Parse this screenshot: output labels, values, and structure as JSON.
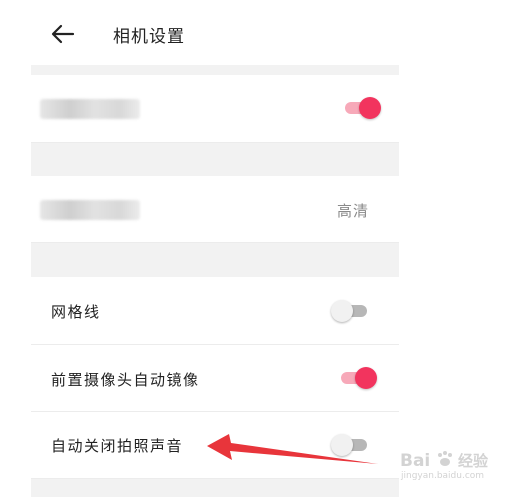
{
  "header": {
    "title": "相机设置",
    "back_icon": "back-arrow-icon"
  },
  "settings": {
    "value_hd": "高清",
    "grid_label": "网格线",
    "grid_state": false,
    "front_mirror_label": "前置摄像头自动镜像",
    "front_mirror_state": true,
    "shutter_sound_label": "自动关闭拍照声音",
    "shutter_sound_state": false,
    "first_toggle_state": true
  },
  "colors": {
    "accent": "#f2345e",
    "accent_track": "#f7a9b9",
    "annotation_arrow": "#e8353b"
  },
  "watermark": {
    "brand": "Bai",
    "suffix": "经验",
    "url": "jingyan.baidu.com"
  }
}
